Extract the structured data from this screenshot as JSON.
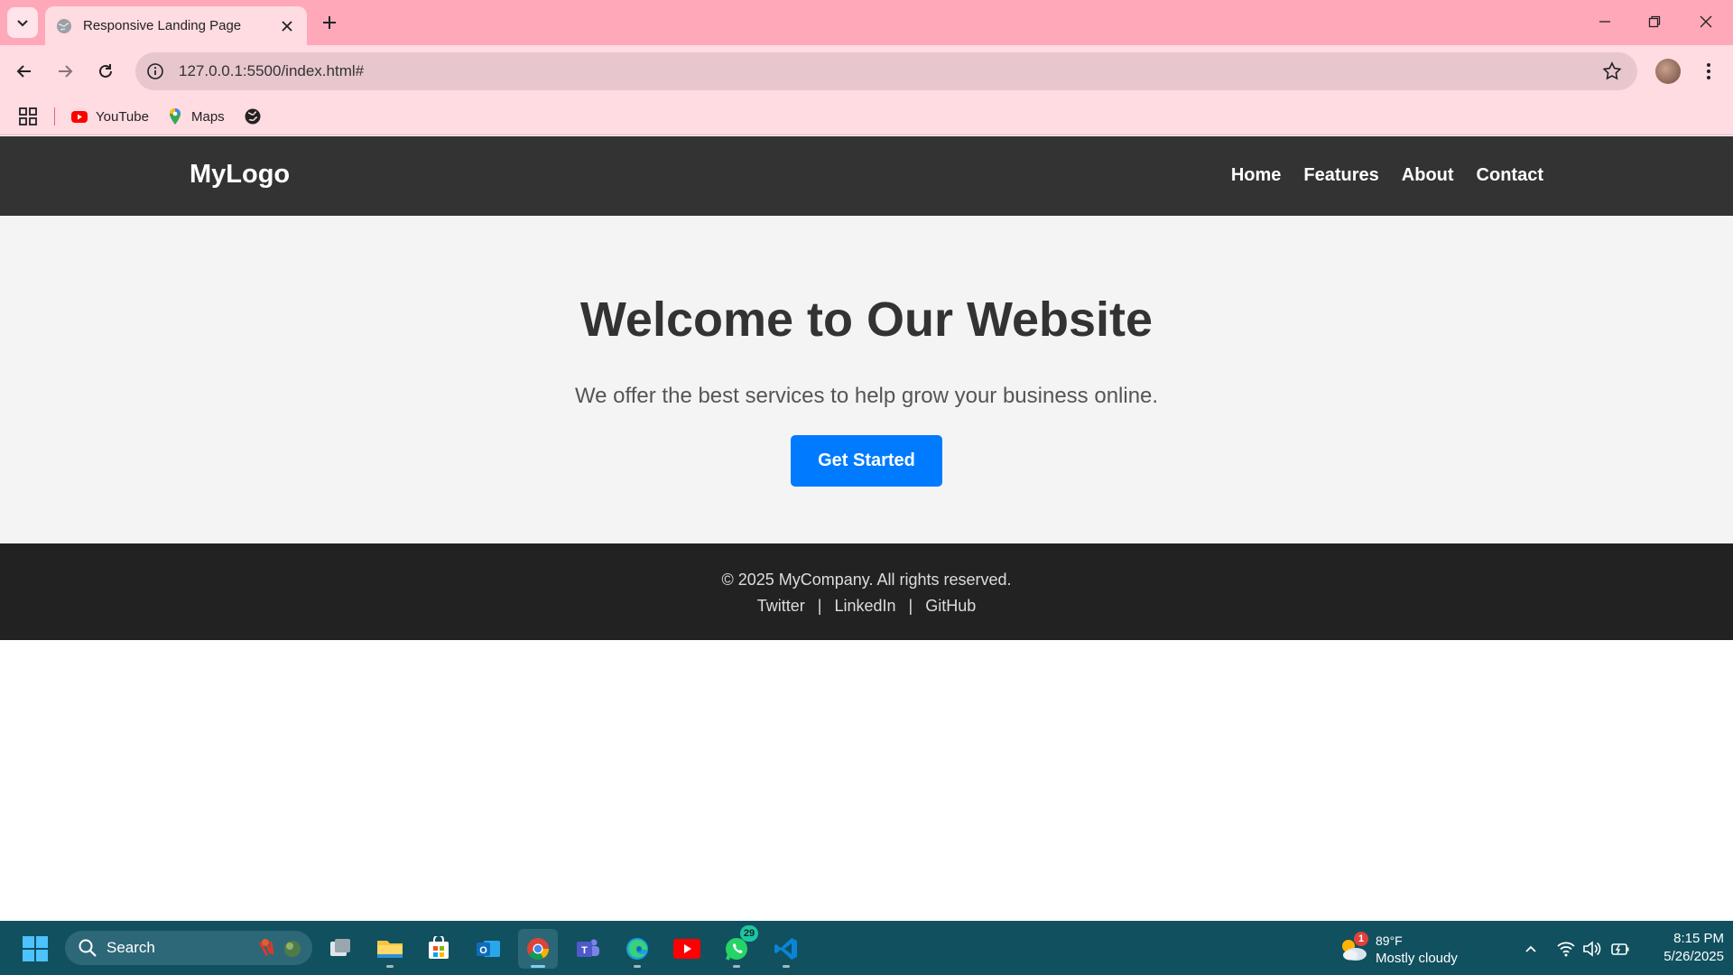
{
  "browser": {
    "tab_title": "Responsive Landing Page",
    "url": "127.0.0.1:5500/index.html#",
    "bookmarks": [
      {
        "label": "YouTube",
        "icon": "youtube-icon"
      },
      {
        "label": "Maps",
        "icon": "maps-icon"
      }
    ]
  },
  "site": {
    "logo": "MyLogo",
    "nav": [
      "Home",
      "Features",
      "About",
      "Contact"
    ],
    "hero": {
      "title": "Welcome to Our Website",
      "subtitle": "We offer the best services to help grow your business online.",
      "cta": "Get Started"
    },
    "footer": {
      "copyright": "© 2025 MyCompany. All rights reserved.",
      "links": [
        "Twitter",
        "LinkedIn",
        "GitHub"
      ],
      "separator": "|"
    },
    "colors": {
      "header_bg": "#333333",
      "hero_bg": "#f4f4f4",
      "cta_bg": "#007bff",
      "footer_bg": "#222222"
    }
  },
  "taskbar": {
    "search_placeholder": "Search",
    "apps": [
      "task-view",
      "file-explorer",
      "microsoft-store",
      "outlook",
      "chrome",
      "teams",
      "edge",
      "youtube",
      "whatsapp",
      "vscode"
    ],
    "whatsapp_badge": "29",
    "weather": {
      "temp": "89°F",
      "condition": "Mostly cloudy",
      "badge": "1"
    },
    "time": "8:15 PM",
    "date": "5/26/2025"
  }
}
